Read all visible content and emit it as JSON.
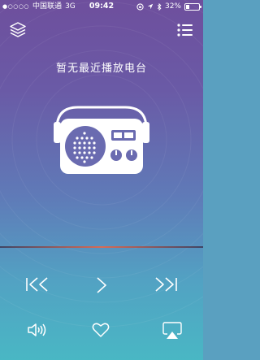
{
  "status_bar": {
    "signal_dots": "●○○○○",
    "carrier": "中国联通",
    "network": "3G",
    "time": "09:42",
    "battery": "32%"
  },
  "main": {
    "empty_text": "暂无最近播放电台"
  },
  "icons": {
    "layers": "layers-icon",
    "menu": "list-menu-icon",
    "radio": "radio-icon",
    "previous": "previous-icon",
    "play": "play-icon",
    "next": "next-icon",
    "volume": "volume-icon",
    "favorite": "heart-icon",
    "airplay": "airplay-icon"
  },
  "colors": {
    "gradient_top": "#6e4f9d",
    "gradient_bottom": "#49b7c4",
    "progress_accent": "#d96a55"
  }
}
